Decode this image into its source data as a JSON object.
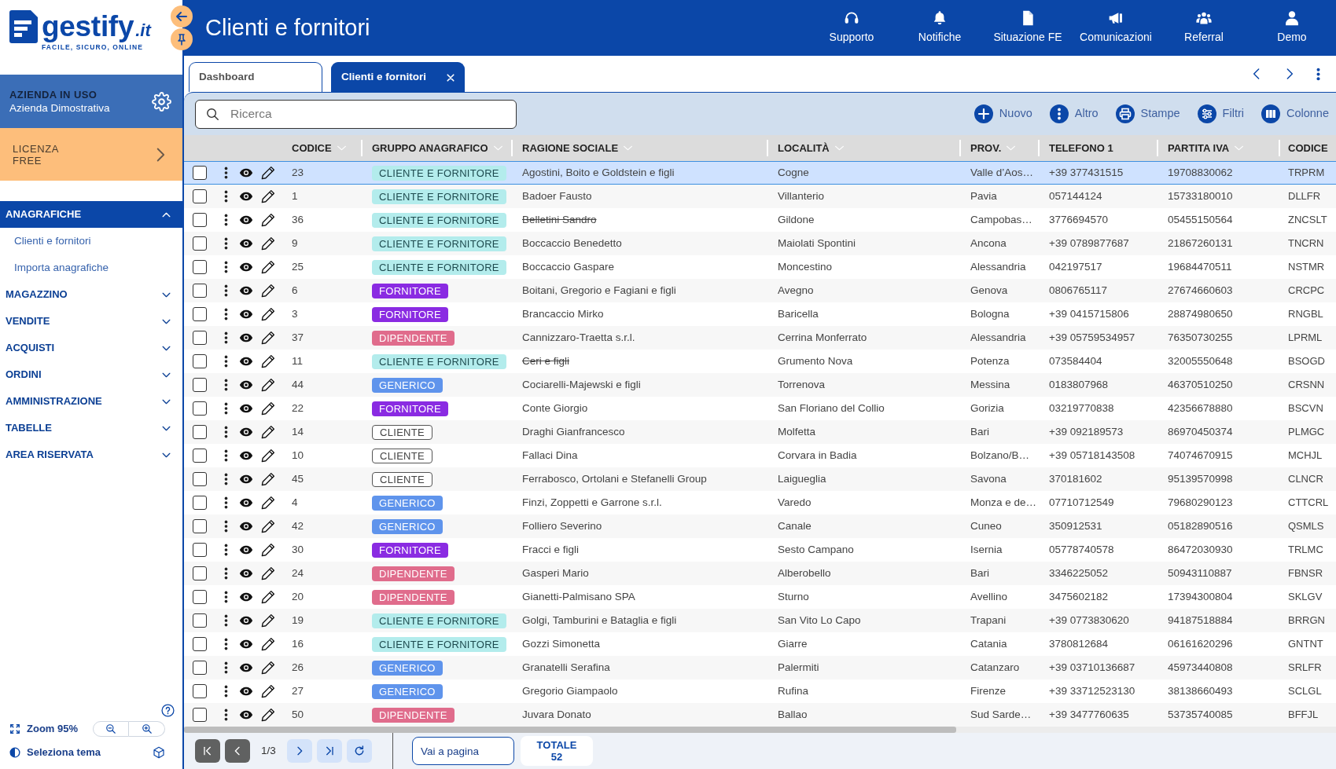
{
  "sidebar": {
    "logo": {
      "wordmark": "gestify",
      "domain": ".it",
      "tagline": "FACILE, SICURO, ONLINE"
    },
    "company": {
      "label": "AZIENDA IN USO",
      "name": "Azienda Dimostrativa"
    },
    "license": {
      "label": "LICENZA",
      "plan": "FREE"
    },
    "menu": [
      {
        "label": "ANAGRAFICHE",
        "expanded": true,
        "children": [
          {
            "label": "Clienti e fornitori"
          },
          {
            "label": "Importa anagrafiche"
          }
        ]
      },
      {
        "label": "MAGAZZINO",
        "expanded": false
      },
      {
        "label": "VENDITE",
        "expanded": false
      },
      {
        "label": "ACQUISTI",
        "expanded": false
      },
      {
        "label": "ORDINI",
        "expanded": false
      },
      {
        "label": "AMMINISTRAZIONE",
        "expanded": false
      },
      {
        "label": "TABELLE",
        "expanded": false
      },
      {
        "label": "AREA RISERVATA",
        "expanded": false
      }
    ],
    "zoom": {
      "label": "Zoom 95%"
    },
    "theme": {
      "label": "Seleziona tema"
    }
  },
  "header": {
    "title": "Clienti e fornitori",
    "nav": [
      {
        "label": "Supporto",
        "kind": "support"
      },
      {
        "label": "Notifiche",
        "kind": "notifications"
      },
      {
        "label": "Situazione FE",
        "kind": "document"
      },
      {
        "label": "Comunicazioni",
        "kind": "announcements"
      },
      {
        "label": "Referral",
        "kind": "referral"
      },
      {
        "label": "Demo",
        "kind": "account"
      }
    ]
  },
  "tabs": [
    {
      "label": "Dashboard",
      "selected": false,
      "closable": false
    },
    {
      "label": "Clienti e fornitori",
      "selected": true,
      "closable": true
    }
  ],
  "toolbar": {
    "search": {
      "placeholder": "Ricerca"
    },
    "buttons": [
      {
        "label": "Nuovo",
        "kind": "add"
      },
      {
        "label": "Altro",
        "kind": "more"
      },
      {
        "label": "Stampe",
        "kind": "print"
      },
      {
        "label": "Filtri",
        "kind": "filter"
      },
      {
        "label": "Colonne",
        "kind": "columns"
      }
    ]
  },
  "table": {
    "columns": [
      {
        "label": "CODICE",
        "dropdown": true
      },
      {
        "label": "GRUPPO ANAGRAFICO",
        "dropdown": true
      },
      {
        "label": "RAGIONE SOCIALE",
        "dropdown": true
      },
      {
        "label": "LOCALITÀ",
        "dropdown": true
      },
      {
        "label": "PROV.",
        "dropdown": true
      },
      {
        "label": "TELEFONO 1",
        "dropdown": false
      },
      {
        "label": "PARTITA IVA",
        "dropdown": true
      },
      {
        "label": "CODICE",
        "dropdown": false
      }
    ],
    "rows": [
      {
        "selected": true,
        "checked": false,
        "codice": "23",
        "group": {
          "label": "CLIENTE E FORNITORE",
          "color": "#b3ecec"
        },
        "ragione_sociale": "Agostini, Boito e Goldstein e figli",
        "struck_through": false,
        "localita": "Cogne",
        "prov": "Valle d’Aos…",
        "telefono_1": "+39 377431515",
        "partita_iva": "19708830062",
        "column_12": "TRPRM"
      },
      {
        "selected": false,
        "checked": false,
        "codice": "1",
        "group": {
          "label": "CLIENTE E FORNITORE",
          "color": "#b3ecec"
        },
        "ragione_sociale": "Badoer Fausto",
        "struck_through": false,
        "localita": "Villanterio",
        "prov": "Pavia",
        "telefono_1": "057144124",
        "partita_iva": "15733180010",
        "column_12": "DLLFR"
      },
      {
        "selected": false,
        "checked": false,
        "codice": "36",
        "group": {
          "label": "CLIENTE E FORNITORE",
          "color": "#b3ecec"
        },
        "ragione_sociale": "Belletini Sandro",
        "struck_through": true,
        "localita": "Gildone",
        "prov": "Campobas…",
        "telefono_1": "3776694570",
        "partita_iva": "05455150564",
        "column_12": "ZNCSLT"
      },
      {
        "selected": false,
        "checked": false,
        "codice": "9",
        "group": {
          "label": "CLIENTE E FORNITORE",
          "color": "#b3ecec"
        },
        "ragione_sociale": "Boccaccio Benedetto",
        "struck_through": false,
        "localita": "Maiolati Spontini",
        "prov": "Ancona",
        "telefono_1": "+39 0789877687",
        "partita_iva": "21867260131",
        "column_12": "TNCRN"
      },
      {
        "selected": false,
        "checked": false,
        "codice": "25",
        "group": {
          "label": "CLIENTE E FORNITORE",
          "color": "#b3ecec"
        },
        "ragione_sociale": "Boccaccio Gaspare",
        "struck_through": false,
        "localita": "Moncestino",
        "prov": "Alessandria",
        "telefono_1": "042197517",
        "partita_iva": "19684470511",
        "column_12": "NSTMR"
      },
      {
        "selected": false,
        "checked": false,
        "codice": "6",
        "group": {
          "label": "FORNITORE",
          "color": "#8a2be2"
        },
        "ragione_sociale": "Boitani, Gregorio e Fagiani e figli",
        "struck_through": false,
        "localita": "Avegno",
        "prov": "Genova",
        "telefono_1": "0806765117",
        "partita_iva": "27674660603",
        "column_12": "CRCPC"
      },
      {
        "selected": false,
        "checked": false,
        "codice": "3",
        "group": {
          "label": "FORNITORE",
          "color": "#8a2be2"
        },
        "ragione_sociale": "Brancaccio Mirko",
        "struck_through": false,
        "localita": "Baricella",
        "prov": "Bologna",
        "telefono_1": "+39 0415715806",
        "partita_iva": "28874980650",
        "column_12": "RNGBL"
      },
      {
        "selected": false,
        "checked": false,
        "codice": "37",
        "group": {
          "label": "DIPENDENTE",
          "color": "#e06c8c"
        },
        "ragione_sociale": "Cannizzaro-Traetta s.r.l.",
        "struck_through": false,
        "localita": "Cerrina Monferrato",
        "prov": "Alessandria",
        "telefono_1": "+39 05759534957",
        "partita_iva": "76350730255",
        "column_12": "LPRML"
      },
      {
        "selected": false,
        "checked": false,
        "codice": "11",
        "group": {
          "label": "CLIENTE E FORNITORE",
          "color": "#b3ecec"
        },
        "ragione_sociale": "Ceri e figli",
        "struck_through": true,
        "localita": "Grumento Nova",
        "prov": "Potenza",
        "telefono_1": "073584404",
        "partita_iva": "32005550648",
        "column_12": "BSOGD"
      },
      {
        "selected": false,
        "checked": false,
        "codice": "44",
        "group": {
          "label": "GENERICO",
          "color": "#5f94ec"
        },
        "ragione_sociale": "Cociarelli-Majewski e figli",
        "struck_through": false,
        "localita": "Torrenova",
        "prov": "Messina",
        "telefono_1": "0183807968",
        "partita_iva": "46370510250",
        "column_12": "CRSNN"
      },
      {
        "selected": false,
        "checked": false,
        "codice": "22",
        "group": {
          "label": "FORNITORE",
          "color": "#8a2be2"
        },
        "ragione_sociale": "Conte Giorgio",
        "struck_through": false,
        "localita": "San Floriano del Collio",
        "prov": "Gorizia",
        "telefono_1": "03219770838",
        "partita_iva": "42356678880",
        "column_12": "BSCVN"
      },
      {
        "selected": false,
        "checked": false,
        "codice": "14",
        "group": {
          "label": "CLIENTE",
          "color": "#ffffff"
        },
        "ragione_sociale": "Draghi Gianfrancesco",
        "struck_through": false,
        "localita": "Molfetta",
        "prov": "Bari",
        "telefono_1": "+39 092189573",
        "partita_iva": "86970450374",
        "column_12": "PLMGC"
      },
      {
        "selected": false,
        "checked": false,
        "codice": "10",
        "group": {
          "label": "CLIENTE",
          "color": "#ffffff"
        },
        "ragione_sociale": "Fallaci Dina",
        "struck_through": false,
        "localita": "Corvara in Badia",
        "prov": "Bolzano/B…",
        "telefono_1": "+39 05718143508",
        "partita_iva": "74074670915",
        "column_12": "MCHJL"
      },
      {
        "selected": false,
        "checked": false,
        "codice": "45",
        "group": {
          "label": "CLIENTE",
          "color": "#ffffff"
        },
        "ragione_sociale": "Ferrabosco, Ortolani e Stefanelli Group",
        "struck_through": false,
        "localita": "Laigueglia",
        "prov": "Savona",
        "telefono_1": "370181602",
        "partita_iva": "95139570998",
        "column_12": "CLNCR"
      },
      {
        "selected": false,
        "checked": false,
        "codice": "4",
        "group": {
          "label": "GENERICO",
          "color": "#5f94ec"
        },
        "ragione_sociale": "Finzi, Zoppetti e Garrone s.r.l.",
        "struck_through": false,
        "localita": "Varedo",
        "prov": "Monza e de…",
        "telefono_1": "07710712549",
        "partita_iva": "79680290123",
        "column_12": "CTTCRL"
      },
      {
        "selected": false,
        "checked": false,
        "codice": "42",
        "group": {
          "label": "GENERICO",
          "color": "#5f94ec"
        },
        "ragione_sociale": "Folliero Severino",
        "struck_through": false,
        "localita": "Canale",
        "prov": "Cuneo",
        "telefono_1": "350912531",
        "partita_iva": "05182890516",
        "column_12": "QSMLS"
      },
      {
        "selected": false,
        "checked": false,
        "codice": "30",
        "group": {
          "label": "FORNITORE",
          "color": "#8a2be2"
        },
        "ragione_sociale": "Fracci e figli",
        "struck_through": false,
        "localita": "Sesto Campano",
        "prov": "Isernia",
        "telefono_1": "05778740578",
        "partita_iva": "86472030930",
        "column_12": "TRLMC"
      },
      {
        "selected": false,
        "checked": false,
        "codice": "24",
        "group": {
          "label": "DIPENDENTE",
          "color": "#e06c8c"
        },
        "ragione_sociale": "Gasperi Mario",
        "struck_through": false,
        "localita": "Alberobello",
        "prov": "Bari",
        "telefono_1": "3346225052",
        "partita_iva": "50943110887",
        "column_12": "FBNSR"
      },
      {
        "selected": false,
        "checked": false,
        "codice": "20",
        "group": {
          "label": "DIPENDENTE",
          "color": "#e06c8c"
        },
        "ragione_sociale": "Gianetti-Palmisano SPA",
        "struck_through": false,
        "localita": "Sturno",
        "prov": "Avellino",
        "telefono_1": "3475602182",
        "partita_iva": "17394300804",
        "column_12": "SKLGV"
      },
      {
        "selected": false,
        "checked": false,
        "codice": "19",
        "group": {
          "label": "CLIENTE E FORNITORE",
          "color": "#b3ecec"
        },
        "ragione_sociale": "Golgi, Tamburini e Bataglia e figli",
        "struck_through": false,
        "localita": "San Vito Lo Capo",
        "prov": "Trapani",
        "telefono_1": "+39 0773830620",
        "partita_iva": "94187518884",
        "column_12": "BRRGN"
      },
      {
        "selected": false,
        "checked": false,
        "codice": "16",
        "group": {
          "label": "CLIENTE E FORNITORE",
          "color": "#b3ecec"
        },
        "ragione_sociale": "Gozzi Simonetta",
        "struck_through": false,
        "localita": "Giarre",
        "prov": "Catania",
        "telefono_1": "3780812684",
        "partita_iva": "06161620296",
        "column_12": "GNTNT"
      },
      {
        "selected": false,
        "checked": false,
        "codice": "26",
        "group": {
          "label": "GENERICO",
          "color": "#5f94ec"
        },
        "ragione_sociale": "Granatelli Serafina",
        "struck_through": false,
        "localita": "Palermiti",
        "prov": "Catanzaro",
        "telefono_1": "+39 03710136687",
        "partita_iva": "45973440808",
        "column_12": "SRLFR"
      },
      {
        "selected": false,
        "checked": false,
        "codice": "27",
        "group": {
          "label": "GENERICO",
          "color": "#5f94ec"
        },
        "ragione_sociale": "Gregorio Giampaolo",
        "struck_through": false,
        "localita": "Rufina",
        "prov": "Firenze",
        "telefono_1": "+39 33712523130",
        "partita_iva": "38138660493",
        "column_12": "SCLGL"
      },
      {
        "selected": false,
        "checked": false,
        "codice": "50",
        "group": {
          "label": "DIPENDENTE",
          "color": "#e06c8c"
        },
        "ragione_sociale": "Juvara Donato",
        "struck_through": false,
        "localita": "Ballao",
        "prov": "Sud Sarde…",
        "telefono_1": "+39 3477760635",
        "partita_iva": "53735740085",
        "column_12": "BFFJL"
      }
    ]
  },
  "pagination": {
    "buttons": [
      {
        "kind": "first",
        "disabled": true
      },
      {
        "kind": "previous",
        "disabled": true
      },
      {
        "kind": "next",
        "disabled": false
      },
      {
        "kind": "last",
        "disabled": false
      },
      {
        "kind": "refresh",
        "disabled": false
      }
    ],
    "page": "1/3",
    "jump": {
      "placeholder": "Vai a pagina"
    },
    "total_label": "TOTALE",
    "total": "52"
  }
}
